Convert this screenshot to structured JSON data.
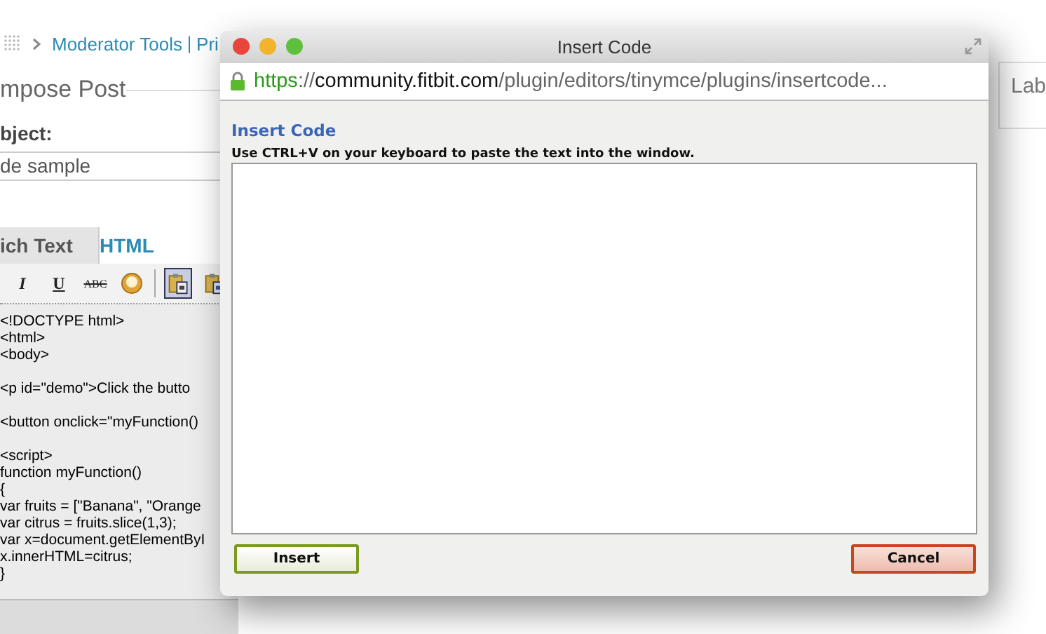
{
  "breadcrumb": {
    "link": "Moderator Tools",
    "separator": "|",
    "next": "Pri"
  },
  "page_title": "mpose Post",
  "subject": {
    "label": "bject:",
    "value": "de sample"
  },
  "editor_tabs": [
    {
      "label": "ich Text",
      "selected": true
    },
    {
      "label": "HTML",
      "selected": false
    }
  ],
  "toolbar": [
    {
      "kind": "italic",
      "label": "I",
      "selected": false
    },
    {
      "kind": "underline",
      "label": "U",
      "selected": false
    },
    {
      "kind": "strike",
      "label": "ABC",
      "selected": false
    },
    {
      "kind": "emoticon",
      "selected": false
    },
    {
      "kind": "paste-code",
      "selected": true
    },
    {
      "kind": "paste-word",
      "selected": false
    }
  ],
  "code_blocks": [
    [
      "<!DOCTYPE html>",
      "<html>",
      "<body>"
    ],
    [
      "<p id=\"demo\">Click the butto"
    ],
    [
      "<button onclick=\"myFunction()"
    ],
    [
      "<script>",
      "function myFunction()",
      "{",
      "var fruits = [\"Banana\", \"Orange",
      "var citrus = fruits.slice(1,3);",
      "var x=document.getElementByI",
      "x.innerHTML=citrus;",
      "}"
    ]
  ],
  "side_panel": {
    "label": "Lab"
  },
  "dialog": {
    "window_title": "Insert Code",
    "url": {
      "scheme": "https",
      "rest_scheme": "://",
      "host": "community.fitbit.com",
      "path": "/plugin/editors/tinymce/plugins/insertcode..."
    },
    "heading": "Insert Code",
    "instruction": "Use CTRL+V on your keyboard to paste the text into the window.",
    "buttons": [
      {
        "label": "Insert",
        "kind": "confirm"
      },
      {
        "label": "Cancel",
        "kind": "cancel"
      }
    ]
  }
}
